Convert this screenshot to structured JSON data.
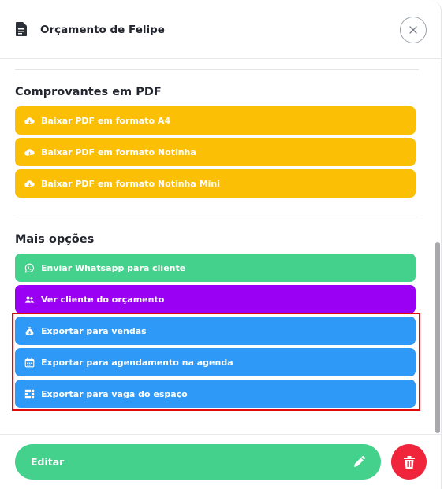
{
  "header": {
    "title": "Orçamento de Felipe",
    "icon": "document-icon",
    "close_icon": "close-icon"
  },
  "pdf_section": {
    "title": "Comprovantes em PDF",
    "buttons": [
      {
        "label": "Baixar PDF em formato A4",
        "icon": "cloud-download-icon"
      },
      {
        "label": "Baixar PDF em formato Notinha",
        "icon": "cloud-download-icon"
      },
      {
        "label": "Baixar PDF em formato Notinha Mini",
        "icon": "cloud-download-icon"
      }
    ]
  },
  "more_section": {
    "title": "Mais opções",
    "buttons": [
      {
        "label": "Enviar Whatsapp para cliente",
        "icon": "whatsapp-icon"
      },
      {
        "label": "Ver cliente do orçamento",
        "icon": "users-icon"
      },
      {
        "label": "Exportar para vendas",
        "icon": "money-bag-icon"
      },
      {
        "label": "Exportar para agendamento na agenda",
        "icon": "calendar-icon"
      },
      {
        "label": "Exportar para vaga do espaço",
        "icon": "grid-slots-icon"
      }
    ]
  },
  "footer": {
    "edit_label": "Editar",
    "edit_icon": "pencil-icon",
    "delete_icon": "trash-icon"
  },
  "colors": {
    "yellow": "#fbbf05",
    "green": "#43d18c",
    "purple": "#9900f4",
    "blue": "#2f99f7",
    "red": "#f0243b",
    "highlight": "#e00a0a"
  }
}
